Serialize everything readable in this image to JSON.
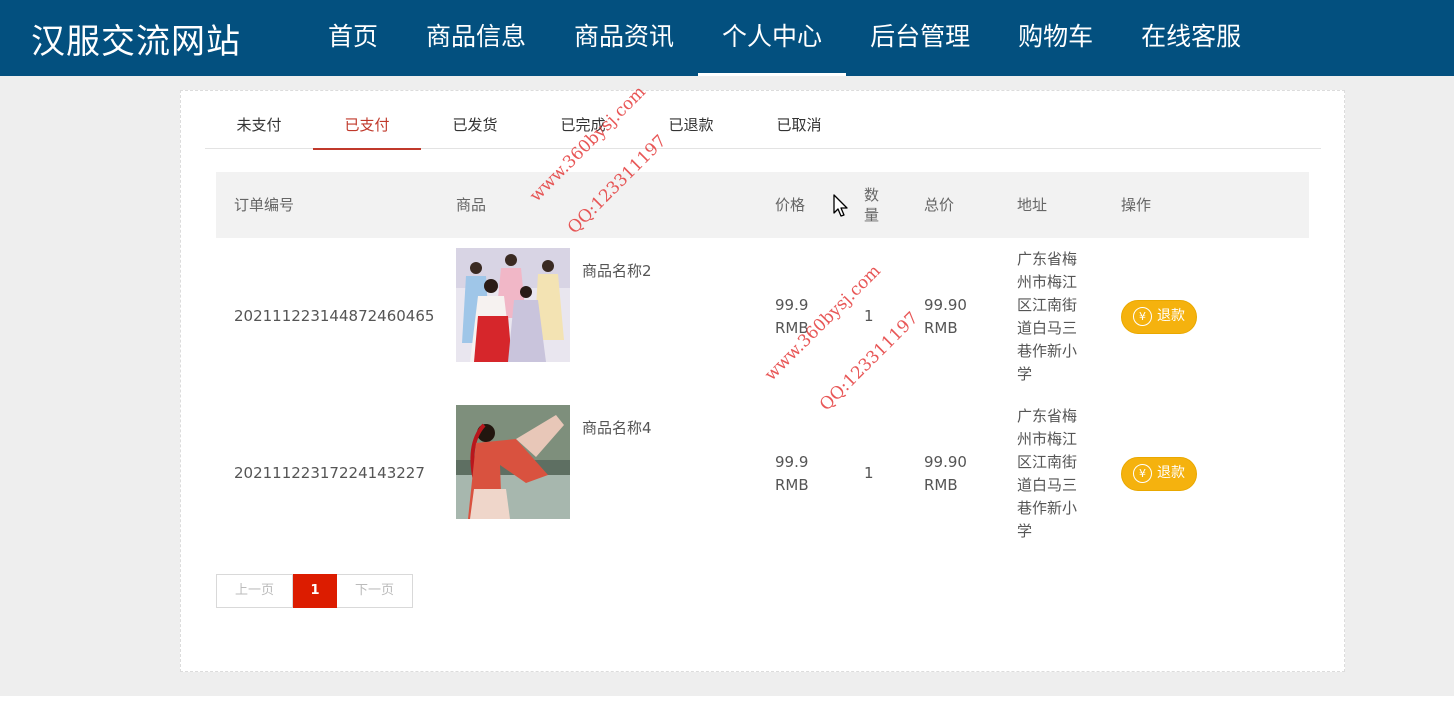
{
  "header": {
    "brand": "汉服交流网站",
    "nav": [
      "首页",
      "商品信息",
      "商品资讯",
      "个人中心",
      "后台管理",
      "购物车",
      "在线客服"
    ],
    "active_nav": "个人中心",
    "bg": "#03507f"
  },
  "tabs": [
    "未支付",
    "已支付",
    "已发货",
    "已完成",
    "已退款",
    "已取消"
  ],
  "active_tab": "已支付",
  "table": {
    "headers": {
      "id": "订单编号",
      "goods": "商品",
      "price": "价格",
      "qty": "数量",
      "total": "总价",
      "addr": "地址",
      "op": "操作"
    },
    "rows": [
      {
        "id": "20211122314487246046​5",
        "goods_name": "商品名称2",
        "price": "99.9 RMB",
        "qty": "1",
        "total": "99.90 RMB",
        "addr": "广东省梅州市梅江区江南街道白马三巷作新小学",
        "action": "退款"
      },
      {
        "id": "2021112231722414322​7",
        "goods_name": "商品名称4",
        "price": "99.9 RMB",
        "qty": "1",
        "total": "99.90 RMB",
        "addr": "广东省梅州市梅江区江南街道白马三巷作新小学",
        "action": "退款"
      }
    ]
  },
  "pager": {
    "prev": "上一页",
    "current": "1",
    "next": "下一页"
  },
  "watermark": {
    "site": "www.360bysj.com",
    "qq": "QQ:123311197"
  },
  "colors": {
    "accent": "#c0392b",
    "refund": "#f5b20e",
    "page_current": "#dc1c00"
  }
}
